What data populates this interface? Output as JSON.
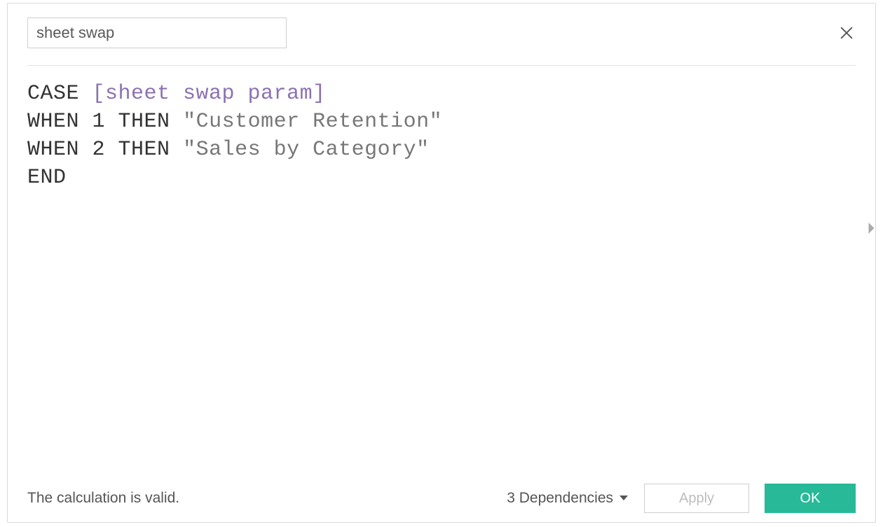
{
  "calculation_name": "sheet swap",
  "formula": {
    "tokens": [
      {
        "t": "kw",
        "v": "CASE "
      },
      {
        "t": "field",
        "v": "[sheet swap param]"
      },
      {
        "t": "nl"
      },
      {
        "t": "kw",
        "v": "WHEN "
      },
      {
        "t": "num",
        "v": "1"
      },
      {
        "t": "kw",
        "v": " THEN "
      },
      {
        "t": "str",
        "v": "\"Customer Retention\""
      },
      {
        "t": "nl"
      },
      {
        "t": "kw",
        "v": "WHEN "
      },
      {
        "t": "num",
        "v": "2"
      },
      {
        "t": "kw",
        "v": " THEN "
      },
      {
        "t": "str",
        "v": "\"Sales by Category\""
      },
      {
        "t": "nl"
      },
      {
        "t": "kw",
        "v": "END"
      }
    ]
  },
  "status_text": "The calculation is valid.",
  "dependencies_label": "3 Dependencies",
  "buttons": {
    "apply": "Apply",
    "ok": "OK"
  }
}
